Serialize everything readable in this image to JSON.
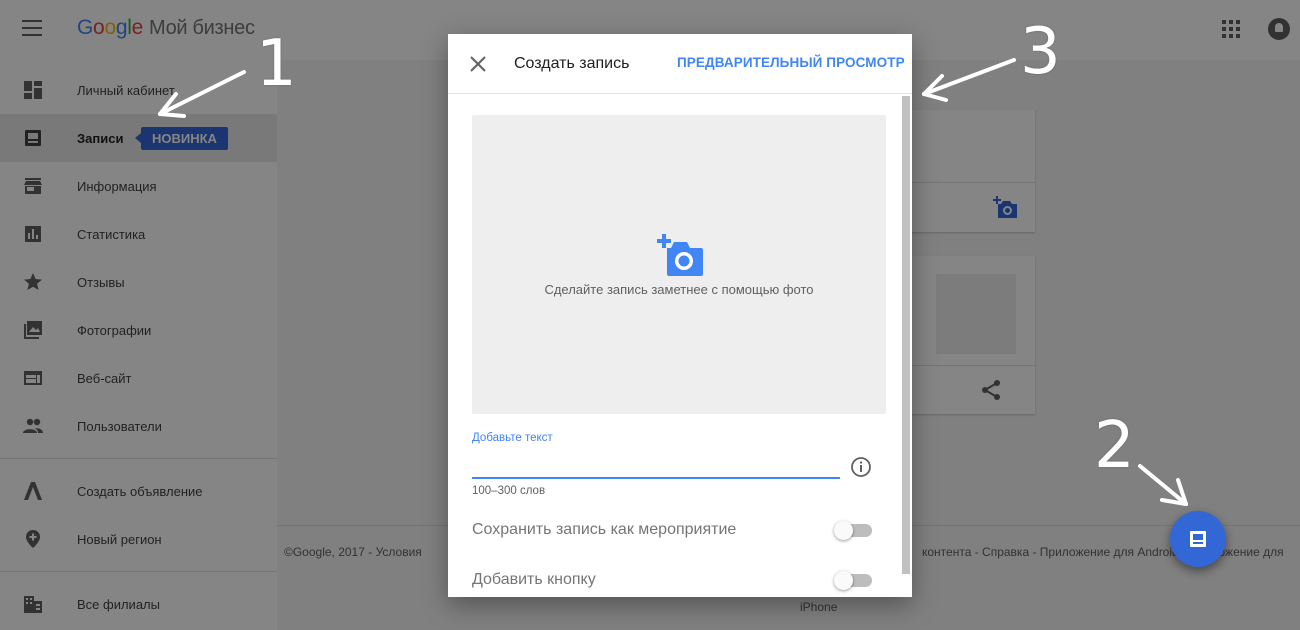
{
  "header": {
    "logo_letters": [
      "G",
      "o",
      "o",
      "g",
      "l",
      "e"
    ],
    "product": "Мой бизнес",
    "menu_icon": "hamburger-menu-icon",
    "apps_icon": "apps-grid-icon",
    "notifications_icon": "notifications-bell-icon"
  },
  "sidebar": {
    "items": [
      {
        "label": "Личный кабинет",
        "icon": "dashboard-icon"
      },
      {
        "label": "Записи",
        "icon": "posts-icon",
        "badge": "НОВИНКА"
      },
      {
        "label": "Информация",
        "icon": "store-icon"
      },
      {
        "label": "Статистика",
        "icon": "bar-chart-icon"
      },
      {
        "label": "Отзывы",
        "icon": "star-icon"
      },
      {
        "label": "Фотографии",
        "icon": "photos-icon"
      },
      {
        "label": "Веб-сайт",
        "icon": "web-icon"
      },
      {
        "label": "Пользователи",
        "icon": "people-icon"
      },
      {
        "label": "Создать объявление",
        "icon": "adwords-icon"
      },
      {
        "label": "Новый регион",
        "icon": "add-location-icon"
      },
      {
        "label": "Все филиалы",
        "icon": "buildings-icon"
      }
    ]
  },
  "footer": {
    "left": "©Google, 2017   -   Условия",
    "right": "контента   -   Справка   -   Приложение для Android   -   Приложение для",
    "iphone": "iPhone"
  },
  "dialog": {
    "title": "Создать запись",
    "preview_label": "ПРЕДВАРИТЕЛЬНЫЙ ПРОСМОТР",
    "photo_hint": "Сделайте запись заметнее с помощью фото",
    "text_label": "Добавьте текст",
    "text_value": "",
    "word_hint": "100–300 слов",
    "event_option": "Сохранить запись как мероприятие",
    "event_enabled": false,
    "button_option": "Добавить кнопку",
    "button_enabled": false
  },
  "annotations": [
    "1",
    "2",
    "3"
  ],
  "colors": {
    "accent": "#4285F4",
    "badge": "#3367d6",
    "fab": "#3367d6"
  }
}
